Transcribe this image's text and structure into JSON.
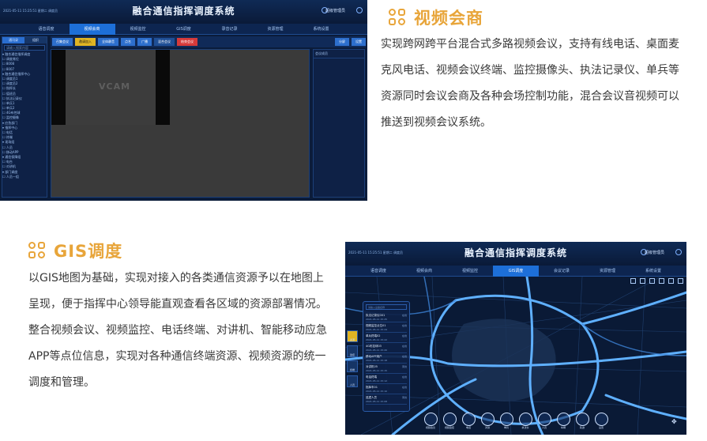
{
  "colors": {
    "accent": "#e8a53a",
    "panel_bg": "#0b1c3a",
    "nav_active": "#1d6fd8",
    "route": "#5fb0ff"
  },
  "video_section": {
    "title": "视频会商",
    "body": "实现跨网跨平台混合式多路视频会议，支持有线电话、桌面麦克风电话、视频会议终端、监控摄像头、执法记录仪、单兵等资源同时会议会商及各种会场控制功能，混合会议音视频可以推送到视频会议系统。"
  },
  "gis_section": {
    "title": "GIS调度",
    "body": "以GIS地图为基础，实现对接入的各类通信资源予以在地图上呈现，便于指挥中心领导能直观查看各区域的资源部署情况。整合视频会议、视频监控、电话终端、对讲机、智能移动应急APP等点位信息，实现对各种通信终端资源、视频资源的统一调度和管理。"
  },
  "app": {
    "title": "融合通信指挥调度系统",
    "datetime": "2021-05-11 15:25:51 星期二  调度员",
    "user": "超级管理员"
  },
  "video_screen": {
    "nav": [
      "语音调度",
      "视频会商",
      "视频监控",
      "GIS调度",
      "录音记录",
      "资源管理",
      "系统设置"
    ],
    "nav_active": 1,
    "tree_tabs": [
      "通讯录",
      "组织"
    ],
    "tree_search": "请输入搜索内容",
    "tree": [
      "▾ 融合通信指挥调度",
      "  ☐ 调度席位",
      "  ☐ 8008",
      "  ☐ 8007",
      "▾ 融合通信指挥中心",
      "  ☐ 调度员1",
      "  ☐ 调度员2",
      "  ☐ 指挥长",
      "  ☐ 值班员",
      "  ☐ 执法记录仪",
      "  ☐ 单兵1",
      "  ☐ 单兵2",
      "  ☐ 4G布控球",
      "  ☐ 监控摄像",
      "▾ 应急部门",
      "  ▾ 指挥中心",
      "    ☐ 电话",
      "    ☐ 终端",
      "  ▾ 现场组",
      "    ☐ 人员",
      "  ☐ 移动APP",
      "▾ 通信保障组",
      "  ☐ 电台",
      "  ☐ 对讲机",
      "▾ 部门调度",
      "  ☐ 人员一组"
    ],
    "controls": [
      "召集会议",
      "邀请加入",
      "全体静音",
      "点名",
      "广播",
      "混合会议",
      "结束会议"
    ],
    "controls_right": [
      "分屏",
      "设置"
    ],
    "video_label": "VCAM",
    "right_panel_title": "会议成员"
  },
  "gis_screen": {
    "nav": [
      "语音调度",
      "视频会商",
      "视频监控",
      "GIS调度",
      "会议记录",
      "资源管理",
      "系统设置"
    ],
    "nav_active": 3,
    "side_buttons": [
      "资源",
      "监控",
      "终端",
      "人员"
    ],
    "side_active": 0,
    "list_search": "请输入设备名称",
    "list_items": [
      {
        "name": "执法记录仪001",
        "time": "2021-05-11 15:25",
        "status": "在线"
      },
      {
        "name": "视频监控点位01",
        "time": "2021-05-11 15:24",
        "status": "在线"
      },
      {
        "name": "单兵终端02",
        "time": "2021-05-11 15:22",
        "status": "在线"
      },
      {
        "name": "4G布控球03",
        "time": "2021-05-11 15:20",
        "status": "在线"
      },
      {
        "name": "移动APP用户",
        "time": "2021-05-11 15:18",
        "status": "在线"
      },
      {
        "name": "对讲机05",
        "time": "2021-05-11 15:15",
        "status": "离线"
      },
      {
        "name": "电话终端",
        "time": "2021-05-11 15:12",
        "status": "在线"
      },
      {
        "name": "指挥车01",
        "time": "2021-05-11 15:10",
        "status": "在线"
      },
      {
        "name": "巡逻人员",
        "time": "2021-05-11 15:08",
        "status": "离线"
      }
    ],
    "bottom_tools": [
      "视频会议",
      "视频监控",
      "电话",
      "对讲",
      "单兵",
      "执法仪",
      "人员",
      "车辆",
      "轨迹",
      "设置"
    ]
  }
}
